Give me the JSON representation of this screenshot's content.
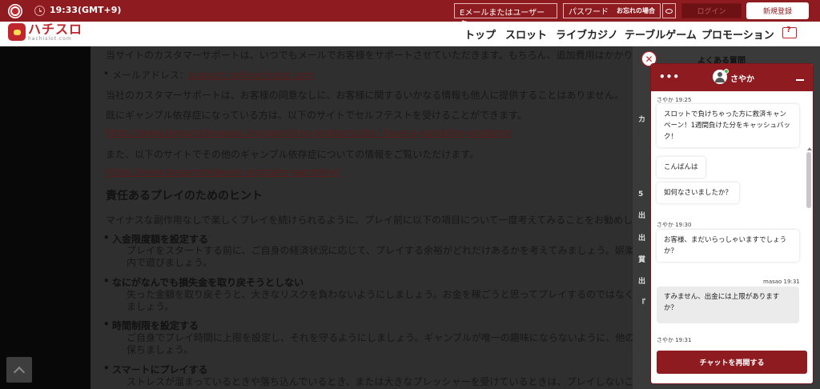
{
  "topbar": {
    "time": "19:33(GMT+9)",
    "email_placeholder": "Eメールまたはユーザー名",
    "password_placeholder": "パスワード",
    "forgot_link": "お忘れの場合",
    "login_label": "ログイン",
    "register_label": "新規登録"
  },
  "brand": {
    "name": "ハチスロ",
    "sub": "hachislot.com"
  },
  "nav": {
    "items": [
      "トップ",
      "スロット",
      "ライブカジノ",
      "テーブルゲーム",
      "プロモーション"
    ]
  },
  "content": {
    "intro": "当サイトのカスタマーサポートは、いつでもメールでお客様をサポートさせていただきます。もちろん、追加費用はかかりません",
    "mail_label": "メールアドレス：",
    "mail_address": "support.jp@hachislot.com",
    "privacy": "当社のカスタマーサポートは、お客様の同意なしに、お客様に関するいかなる情報も他人に提供することはありません。",
    "selftest": "既にギャンブル依存症になっている方は、以下のサイトでセルフテストを受けることができます。",
    "link1": "https://www.begambleaware.org/gambling-problems/do-i-have-a-gambling-problem/",
    "other_info": "また、以下のサイトでその他のギャンブル依存症についての情報をご覧いただけます。",
    "link2": "https://www.begambleaware.org/safer-gambling/",
    "heading": "責任あるプレイのためのヒント",
    "lead": "マイナスな副作用なしで楽しくプレイを続けられるように、プレイ前に以下の項目について一度考えてみることをお勧めします",
    "tips": [
      {
        "title": "入金限度額を設定する",
        "line1": "プレイをスタートする前に、ご自身の経済状況に応じて、プレイする余裕がどれだけあるかを考えてみましょう。娯楽とし",
        "line2": "内で遊びましょう。"
      },
      {
        "title": "なにがなんでも損失金を取り戻そうとしない",
        "line1": "失った金額を取り戻そうと、大きなリスクを負わないようにしましょう。お金を稼ごうと思ってプレイするのではなく、娯楽",
        "line2": "ましょう。"
      },
      {
        "title": "時間制限を設定する",
        "line1": "ご自身でプレイ時間に上限を設定し、それを守るようにしましょう。ギャンブルが唯一の趣味にならないように、他の趣味",
        "line2": "保ちましょう。"
      },
      {
        "title": "スマートにプレイする",
        "line1": "ストレスが溜まっているときや落ち込んでいるとき、または大きなプレッシャーを受けているときは、プレイしないことが",
        "line2": ""
      }
    ]
  },
  "faq": {
    "title": "よくある質問",
    "bits": [
      "カ",
      "5",
      "出",
      "出",
      "賞",
      "出",
      "『"
    ]
  },
  "chat": {
    "agent_name": "さやか",
    "menu_label": "•••",
    "messages": [
      {
        "meta": "さやか 19:25",
        "text": "スロットで負けちゃった方に救済キャンペーン！1週間負けた分をキャッシュバック！"
      },
      {
        "meta": "",
        "text": "こんばんは"
      },
      {
        "meta": "",
        "text": "如何なさいましたか？"
      },
      {
        "meta": "さやか 19:30",
        "text": "お客様、まだいらっしゃいますでしょうか？"
      },
      {
        "meta": "masao 19:31",
        "text": "すみません、出金には上限がありますか？"
      },
      {
        "meta": "さやか 19:31",
        "text": ""
      }
    ],
    "restart_label": "チャットを再開する"
  }
}
